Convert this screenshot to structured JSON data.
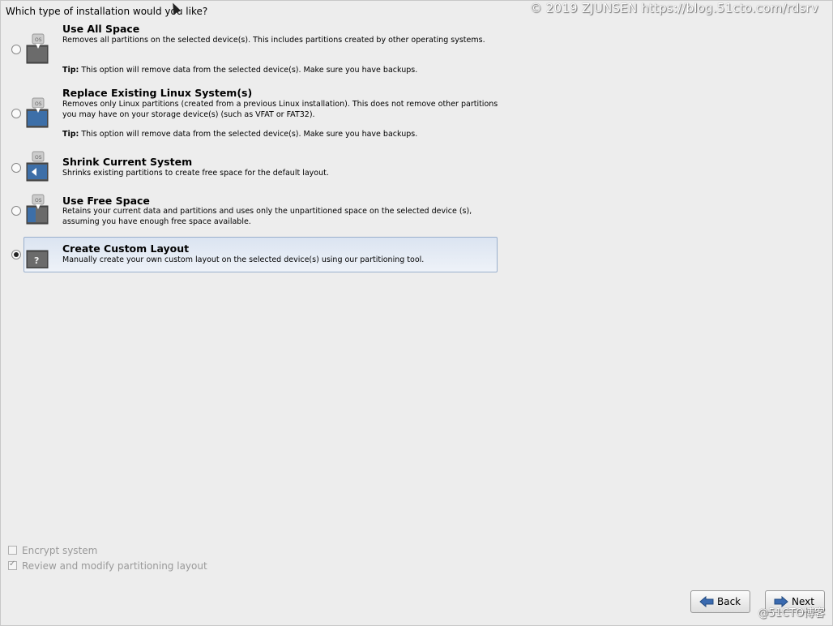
{
  "header": {
    "question": "Which type of installation would you like?",
    "watermark": "© 2019 ZJUNSEN https://blog.51cto.com/rdsrv",
    "watermark_bottom": "@51CTO博客"
  },
  "options": [
    {
      "title": "Use All Space",
      "desc": "Removes all partitions on the selected device(s).  This includes partitions created by other operating systems.",
      "tip_label": "Tip:",
      "tip": " This option will remove data from the selected device(s).  Make sure you have backups.",
      "icon": "os-disk-clear-icon",
      "selected": false
    },
    {
      "title": "Replace Existing Linux System(s)",
      "desc": "Removes only Linux partitions (created from a previous Linux installation).  This does not remove other partitions you may have on your storage device(s) (such as VFAT or FAT32).",
      "tip_label": "Tip:",
      "tip": " This option will remove data from the selected device(s).  Make sure you have backups.",
      "icon": "os-disk-replace-icon",
      "selected": false
    },
    {
      "title": "Shrink Current System",
      "desc": "Shrinks existing partitions to create free space for the default layout.",
      "icon": "os-disk-shrink-icon",
      "selected": false
    },
    {
      "title": "Use Free Space",
      "desc": "Retains your current data and partitions and uses only the unpartitioned space on the selected device (s), assuming you have enough free space available.",
      "icon": "os-disk-freespace-icon",
      "selected": false
    },
    {
      "title": "Create Custom Layout",
      "desc": "Manually create your own custom layout on the selected device(s) using our partitioning tool.",
      "icon": "custom-layout-question-icon",
      "selected": true
    }
  ],
  "checks": {
    "encrypt": "Encrypt system",
    "review": "Review and modify partitioning layout"
  },
  "buttons": {
    "back": "Back",
    "next": "Next"
  },
  "colors": {
    "selected_bg": "#dbe4f1",
    "accent_arrow": "#3a6ab0"
  }
}
